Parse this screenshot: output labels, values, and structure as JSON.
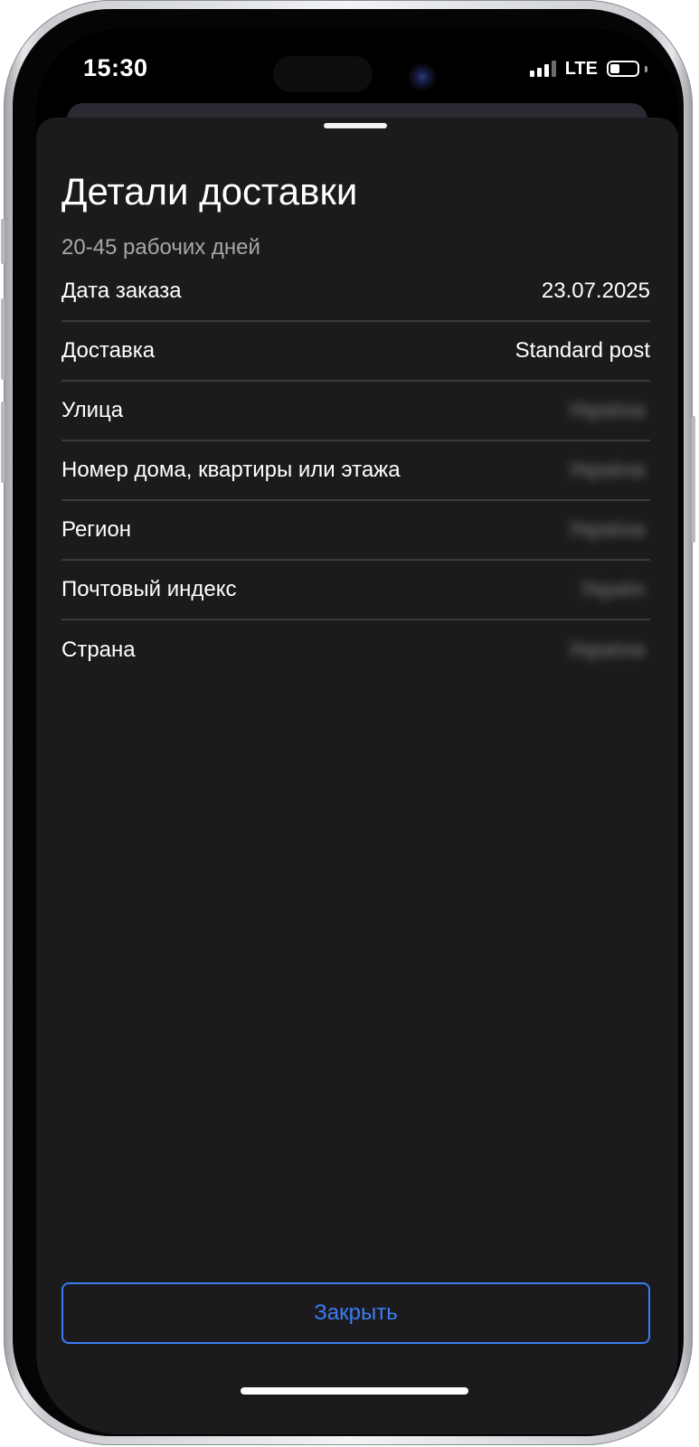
{
  "status_bar": {
    "time": "15:30",
    "network": "LTE",
    "signal_bars": 3,
    "signal_bars_total": 4,
    "battery_level": 0.35
  },
  "sheet": {
    "title": "Детали доставки",
    "subtitle": "20-45 рабочих дней",
    "rows": [
      {
        "label": "Дата заказа",
        "value": "23.07.2025"
      },
      {
        "label": "Доставка",
        "value": "Standard post"
      },
      {
        "label": "Улица",
        "value": "Україна"
      },
      {
        "label": "Номер дома, квартиры или этажа",
        "value": "Україна"
      },
      {
        "label": "Регион",
        "value": "Україна"
      },
      {
        "label": "Почтовый индекс",
        "value": "Україн"
      },
      {
        "label": "Страна",
        "value": "Україна"
      }
    ],
    "close_label": "Закрыть"
  },
  "colors": {
    "sheet_background": "#1b1b1d",
    "accent": "#3b7df2",
    "secondary_text": "#a7a7aa",
    "divider": "#3a3a3d"
  },
  "icons": [
    "signal-icon",
    "battery-icon"
  ]
}
